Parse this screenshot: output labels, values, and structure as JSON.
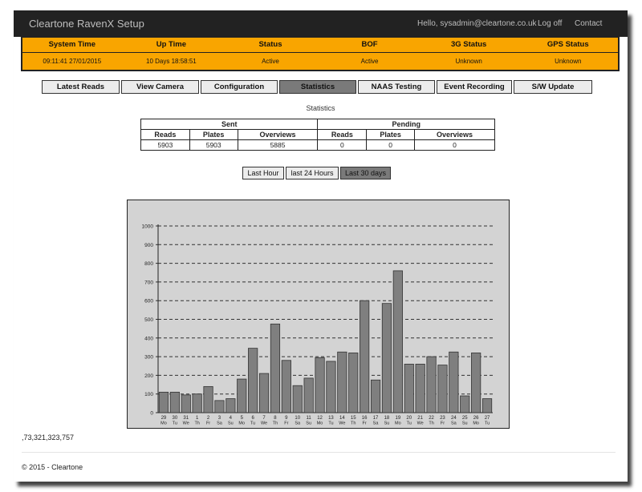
{
  "header": {
    "app_title": "Cleartone RavenX Setup",
    "greeting": "Hello, sysadmin@cleartone.co.uk",
    "logoff": "Log off",
    "contact": "Contact"
  },
  "status": {
    "headers": [
      "System Time",
      "Up Time",
      "Status",
      "BOF",
      "3G Status",
      "GPS Status"
    ],
    "values": [
      "09:11:41 27/01/2015",
      "10 Days 18:58:51",
      "Active",
      "Active",
      "Unknown",
      "Unknown"
    ]
  },
  "tabs": [
    "Latest Reads",
    "View Camera",
    "Configuration",
    "Statistics",
    "NAAS Testing",
    "Event Recording",
    "S/W Update"
  ],
  "active_tab_index": 3,
  "section_title": "Statistics",
  "stats_table": {
    "group_sent": "Sent",
    "group_pending": "Pending",
    "columns": [
      "Reads",
      "Plates",
      "Overviews",
      "Reads",
      "Plates",
      "Overviews"
    ],
    "values": [
      "5903",
      "5903",
      "5885",
      "0",
      "0",
      "0"
    ]
  },
  "range_buttons": [
    "Last Hour",
    "last 24 Hours",
    "Last 30 days"
  ],
  "active_range_index": 2,
  "chart_data": {
    "type": "bar",
    "ylim": [
      0,
      1000
    ],
    "yticks": [
      "0",
      "100",
      "200",
      "300",
      "400",
      "500",
      "600",
      "700",
      "800",
      "900",
      "1000"
    ],
    "grid": true,
    "bar_color": "#7f7f7f",
    "bg_color": "#d3d3d3",
    "categories": [
      {
        "day": "29",
        "dow": "Mo"
      },
      {
        "day": "30",
        "dow": "Tu"
      },
      {
        "day": "31",
        "dow": "We"
      },
      {
        "day": "1",
        "dow": "Th"
      },
      {
        "day": "2",
        "dow": "Fr"
      },
      {
        "day": "3",
        "dow": "Sa"
      },
      {
        "day": "4",
        "dow": "Su"
      },
      {
        "day": "5",
        "dow": "Mo"
      },
      {
        "day": "6",
        "dow": "Tu"
      },
      {
        "day": "7",
        "dow": "We"
      },
      {
        "day": "8",
        "dow": "Th"
      },
      {
        "day": "9",
        "dow": "Fr"
      },
      {
        "day": "10",
        "dow": "Sa"
      },
      {
        "day": "11",
        "dow": "Su"
      },
      {
        "day": "12",
        "dow": "Mo"
      },
      {
        "day": "13",
        "dow": "Tu"
      },
      {
        "day": "14",
        "dow": "We"
      },
      {
        "day": "15",
        "dow": "Th"
      },
      {
        "day": "16",
        "dow": "Fr"
      },
      {
        "day": "17",
        "dow": "Sa"
      },
      {
        "day": "18",
        "dow": "Su"
      },
      {
        "day": "19",
        "dow": "Mo"
      },
      {
        "day": "20",
        "dow": "Tu"
      },
      {
        "day": "21",
        "dow": "We"
      },
      {
        "day": "22",
        "dow": "Th"
      },
      {
        "day": "23",
        "dow": "Fr"
      },
      {
        "day": "24",
        "dow": "Sa"
      },
      {
        "day": "25",
        "dow": "Su"
      },
      {
        "day": "26",
        "dow": "Mo"
      },
      {
        "day": "27",
        "dow": "Tu"
      }
    ],
    "values": [
      110,
      110,
      95,
      100,
      140,
      65,
      75,
      180,
      345,
      210,
      475,
      280,
      145,
      185,
      295,
      275,
      325,
      320,
      600,
      175,
      585,
      760,
      260,
      260,
      300,
      255,
      325,
      90,
      320,
      75
    ]
  },
  "footer_data": ",73,321,323,757",
  "copyright": "© 2015 - Cleartone"
}
